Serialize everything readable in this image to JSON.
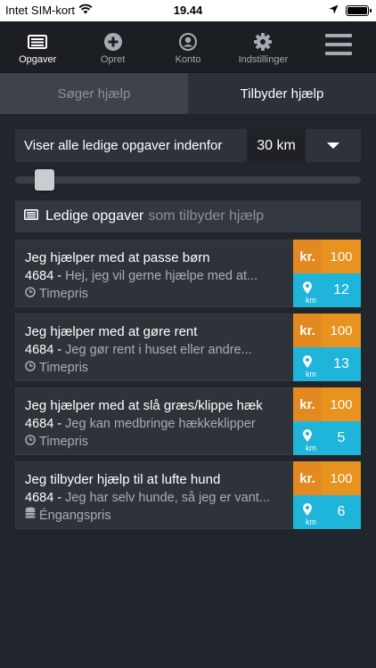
{
  "status_bar": {
    "carrier": "Intet SIM-kort",
    "time": "19.44"
  },
  "nav": [
    {
      "label": "Opgaver",
      "icon": "list-icon",
      "active": true
    },
    {
      "label": "Opret",
      "icon": "plus-circle-icon",
      "active": false
    },
    {
      "label": "Konto",
      "icon": "user-icon",
      "active": false
    },
    {
      "label": "Indstillinger",
      "icon": "gear-icon",
      "active": false
    }
  ],
  "tabs": {
    "seeking": "Søger hjælp",
    "offering": "Tilbyder hjælp"
  },
  "filter": {
    "label": "Viser alle ledige opgaver indenfor",
    "value": "30 km",
    "slider_fraction": 0.08
  },
  "section": {
    "title": "Ledige opgaver",
    "subtitle": "som tilbyder hjælp"
  },
  "cards": [
    {
      "title": "Jeg hjælper med at passe børn",
      "code": "4684",
      "separator": "-",
      "desc": "Hej, jeg vil gerne hjælpe med at...",
      "pricing": "Timepris",
      "pricing_icon": "clock-icon",
      "currency": "kr.",
      "price": "100",
      "distance": "12",
      "unit": "km"
    },
    {
      "title": "Jeg hjælper med at gøre rent",
      "code": "4684",
      "separator": "-",
      "desc": "Jeg gør rent i huset eller andre...",
      "pricing": "Timepris",
      "pricing_icon": "clock-icon",
      "currency": "kr.",
      "price": "100",
      "distance": "13",
      "unit": "km"
    },
    {
      "title": "Jeg hjælper med at slå græs/klippe hæk",
      "code": "4684",
      "separator": "-",
      "desc": "Jeg kan medbringe hækkeklipper",
      "pricing": "Timepris",
      "pricing_icon": "clock-icon",
      "currency": "kr.",
      "price": "100",
      "distance": "5",
      "unit": "km"
    },
    {
      "title": "Jeg tilbyder hjælp til at lufte hund",
      "code": "4684",
      "separator": "-",
      "desc": "Jeg har selv hunde, så jeg er vant...",
      "pricing": "Éngangspris",
      "pricing_icon": "coins-icon",
      "currency": "kr.",
      "price": "100",
      "distance": "6",
      "unit": "km"
    }
  ],
  "colors": {
    "price": "#e28a1f",
    "distance": "#1fb4d9",
    "background": "#21252c"
  }
}
